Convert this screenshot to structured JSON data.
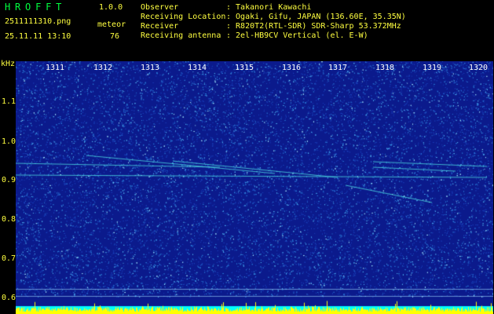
{
  "header": {
    "app_title": "HROFFT",
    "version": "1.0.0",
    "filename": "2511111310.png",
    "datetime": "25.11.11 13:10",
    "meteor_label": "meteor",
    "meteor_count": "76"
  },
  "metadata": [
    {
      "label": "Observer",
      "value": ": Takanori Kawachi"
    },
    {
      "label": "Receiving Location",
      "value": ": Ogaki, Gifu, JAPAN (136.60E, 35.35N)"
    },
    {
      "label": "Receiver",
      "value": ": R820T2(RTL-SDR) SDR-Sharp 53.372MHz"
    },
    {
      "label": "Receiving antenna",
      "value": ": 2el-HB9CV Vertical (el. E-W)"
    }
  ],
  "axis": {
    "unit": "kHz",
    "y_ticks": [
      "1.1",
      "1.0",
      "0.9",
      "0.8",
      "0.7",
      "0.6"
    ],
    "time_ticks": [
      "1311",
      "1312",
      "1313",
      "1314",
      "1315",
      "1316",
      "1317",
      "1318",
      "1319",
      "1320"
    ]
  },
  "colors": {
    "background": "#0b1a8c",
    "noise": "#2a7bd8",
    "trail": "#40e0e0",
    "amplitude": "#ffff00",
    "cyan_band": "#00ffff"
  }
}
